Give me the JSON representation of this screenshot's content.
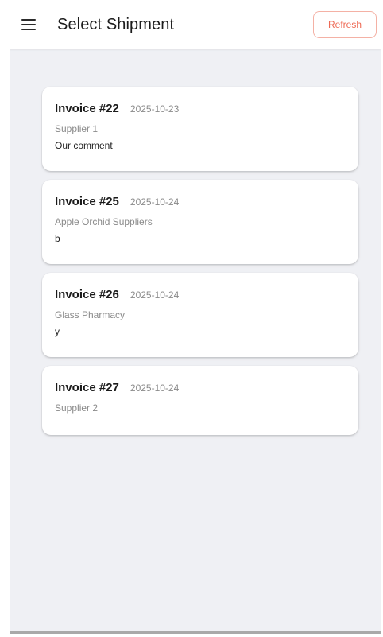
{
  "header": {
    "title": "Select Shipment",
    "refresh_label": "Refresh",
    "menu_icon": "hamburger-menu-icon"
  },
  "colors": {
    "accent": "#ee6a55",
    "background": "#eff0f4",
    "card": "#ffffff"
  },
  "shipments": [
    {
      "invoice": "Invoice #22",
      "date": "2025-10-23",
      "supplier": "Supplier 1",
      "comment": "Our comment"
    },
    {
      "invoice": "Invoice #25",
      "date": "2025-10-24",
      "supplier": "Apple Orchid Suppliers",
      "comment": "b"
    },
    {
      "invoice": "Invoice #26",
      "date": "2025-10-24",
      "supplier": "Glass Pharmacy",
      "comment": "y"
    },
    {
      "invoice": "Invoice #27",
      "date": "2025-10-24",
      "supplier": "Supplier 2",
      "comment": ""
    }
  ]
}
